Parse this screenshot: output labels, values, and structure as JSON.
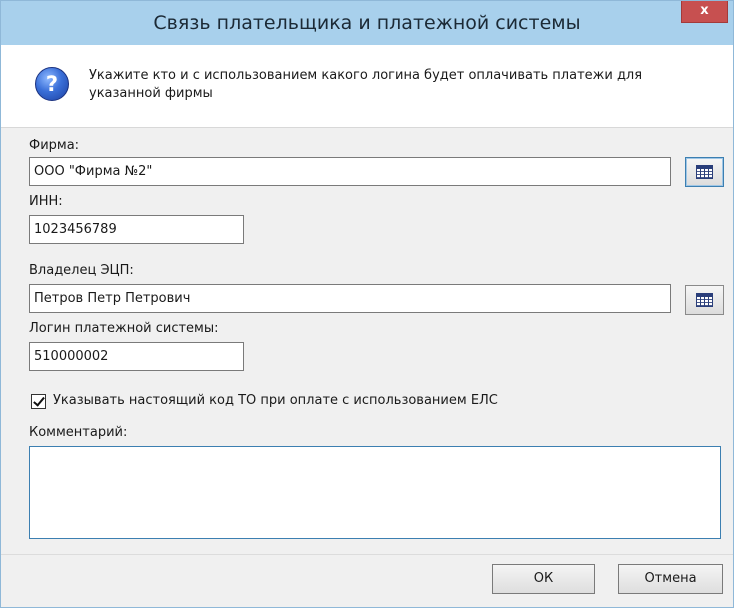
{
  "window": {
    "title": "Связь плательщика и платежной системы",
    "close_label": "x"
  },
  "info": {
    "icon": "question-icon",
    "icon_glyph": "?",
    "text": "Укажите кто и с использованием какого логина будет оплачивать платежи для указанной фирмы"
  },
  "form": {
    "firm_label": "Фирма:",
    "firm_value": "ООО \"Фирма №2\"",
    "inn_label": "ИНН:",
    "inn_value": "1023456789",
    "owner_label": "Владелец ЭЦП:",
    "owner_value": "Петров Петр Петрович",
    "login_label": "Логин платежной системы:",
    "login_value": "510000002",
    "checkbox_label": "Указывать настоящий код ТО при оплате с использованием ЕЛС",
    "checkbox_checked": true,
    "comment_label": "Комментарий:",
    "comment_value": ""
  },
  "buttons": {
    "ok": "ОК",
    "cancel": "Отмена"
  },
  "colors": {
    "titlebar": "#a8d0ec",
    "close": "#c75050",
    "focus_border": "#3c7fb1"
  }
}
